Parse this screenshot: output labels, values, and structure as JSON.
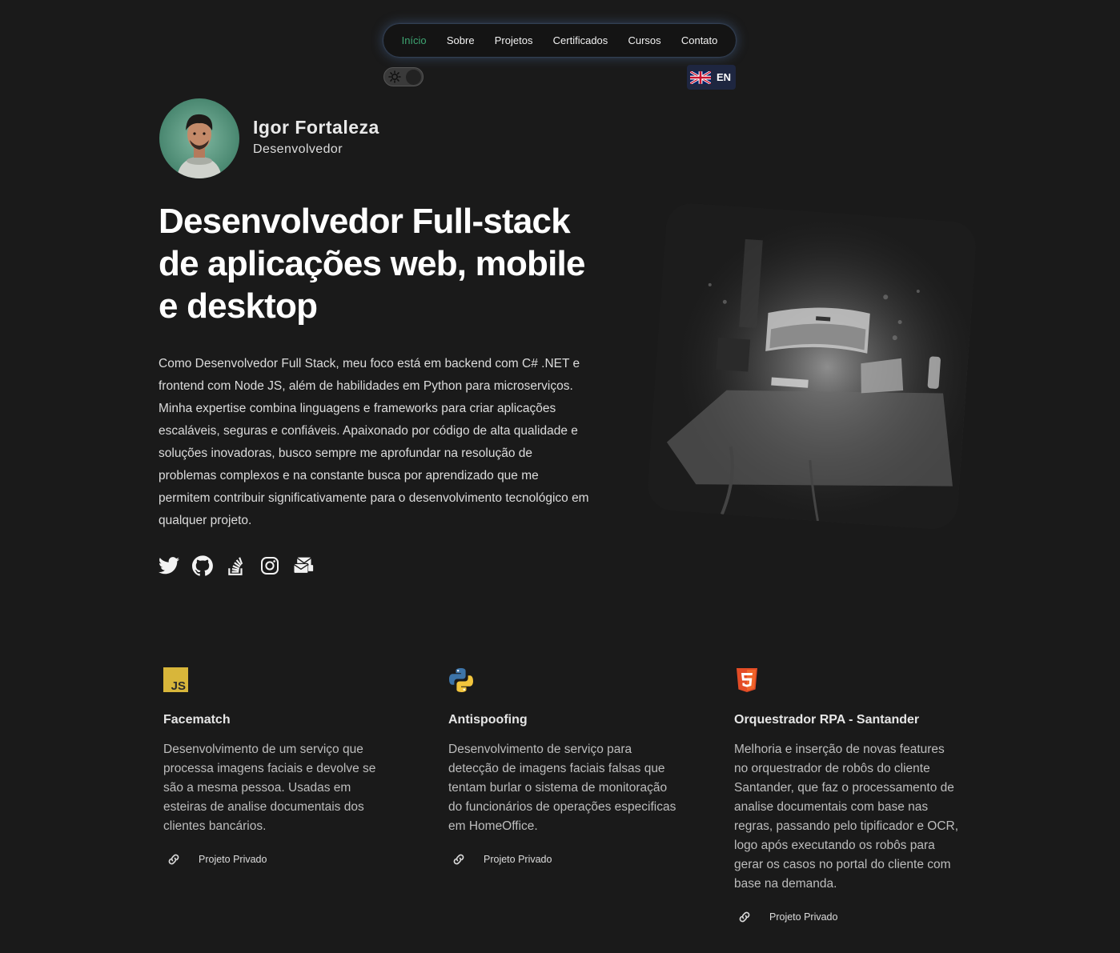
{
  "nav": {
    "items": [
      {
        "label": "Início",
        "active": true
      },
      {
        "label": "Sobre"
      },
      {
        "label": "Projetos"
      },
      {
        "label": "Certificados"
      },
      {
        "label": "Cursos"
      },
      {
        "label": "Contato"
      }
    ],
    "active_color": "#3ea572"
  },
  "theme_toggle": {
    "icon": "sun-icon",
    "state": "dark"
  },
  "language": {
    "code": "EN",
    "flag": "uk-flag-icon"
  },
  "profile": {
    "name": "Igor Fortaleza",
    "role": "Desenvolvedor"
  },
  "hero": {
    "headline": "Desenvolvedor Full-stack de aplicações web, mobile e desktop",
    "bio": "Como Desenvolvedor Full Stack, meu foco está em backend com C# .NET e frontend com Node JS, além de habilidades em Python para microserviços. Minha expertise combina linguagens e frameworks para criar aplicações escaláveis, seguras e confiáveis. Apaixonado por código de alta qualidade e soluções inovadoras, busco sempre me aprofundar na resolução de problemas complexos e na constante busca por aprendizado que me permitem contribuir significativamente para o desenvolvimento tecnológico em qualquer projeto."
  },
  "socials": [
    "twitter-icon",
    "github-icon",
    "stackoverflow-icon",
    "instagram-icon",
    "mail-icon"
  ],
  "projects": [
    {
      "icon": "javascript-icon",
      "title": "Facematch",
      "description": "Desenvolvimento de um serviço que processa imagens faciais e devolve se são a mesma pessoa. Usadas em esteiras de analise documentais dos clientes bancários.",
      "link_label": "Projeto Privado"
    },
    {
      "icon": "python-icon",
      "title": "Antispoofing",
      "description": "Desenvolvimento de serviço para detecção de imagens faciais falsas que tentam burlar o sistema de monitoração do funcionários de operações especificas em HomeOffice.",
      "link_label": "Projeto Privado"
    },
    {
      "icon": "html5-icon",
      "title": "Orquestrador RPA - Santander",
      "description": "Melhoria e inserção de novas features no orquestrador de robôs do cliente Santander, que faz o processamento de analise documentais com base nas regras, passando pelo tipificador e OCR, logo após executando os robôs para gerar os casos no portal do cliente com base na demanda.",
      "link_label": "Projeto Privado"
    }
  ]
}
